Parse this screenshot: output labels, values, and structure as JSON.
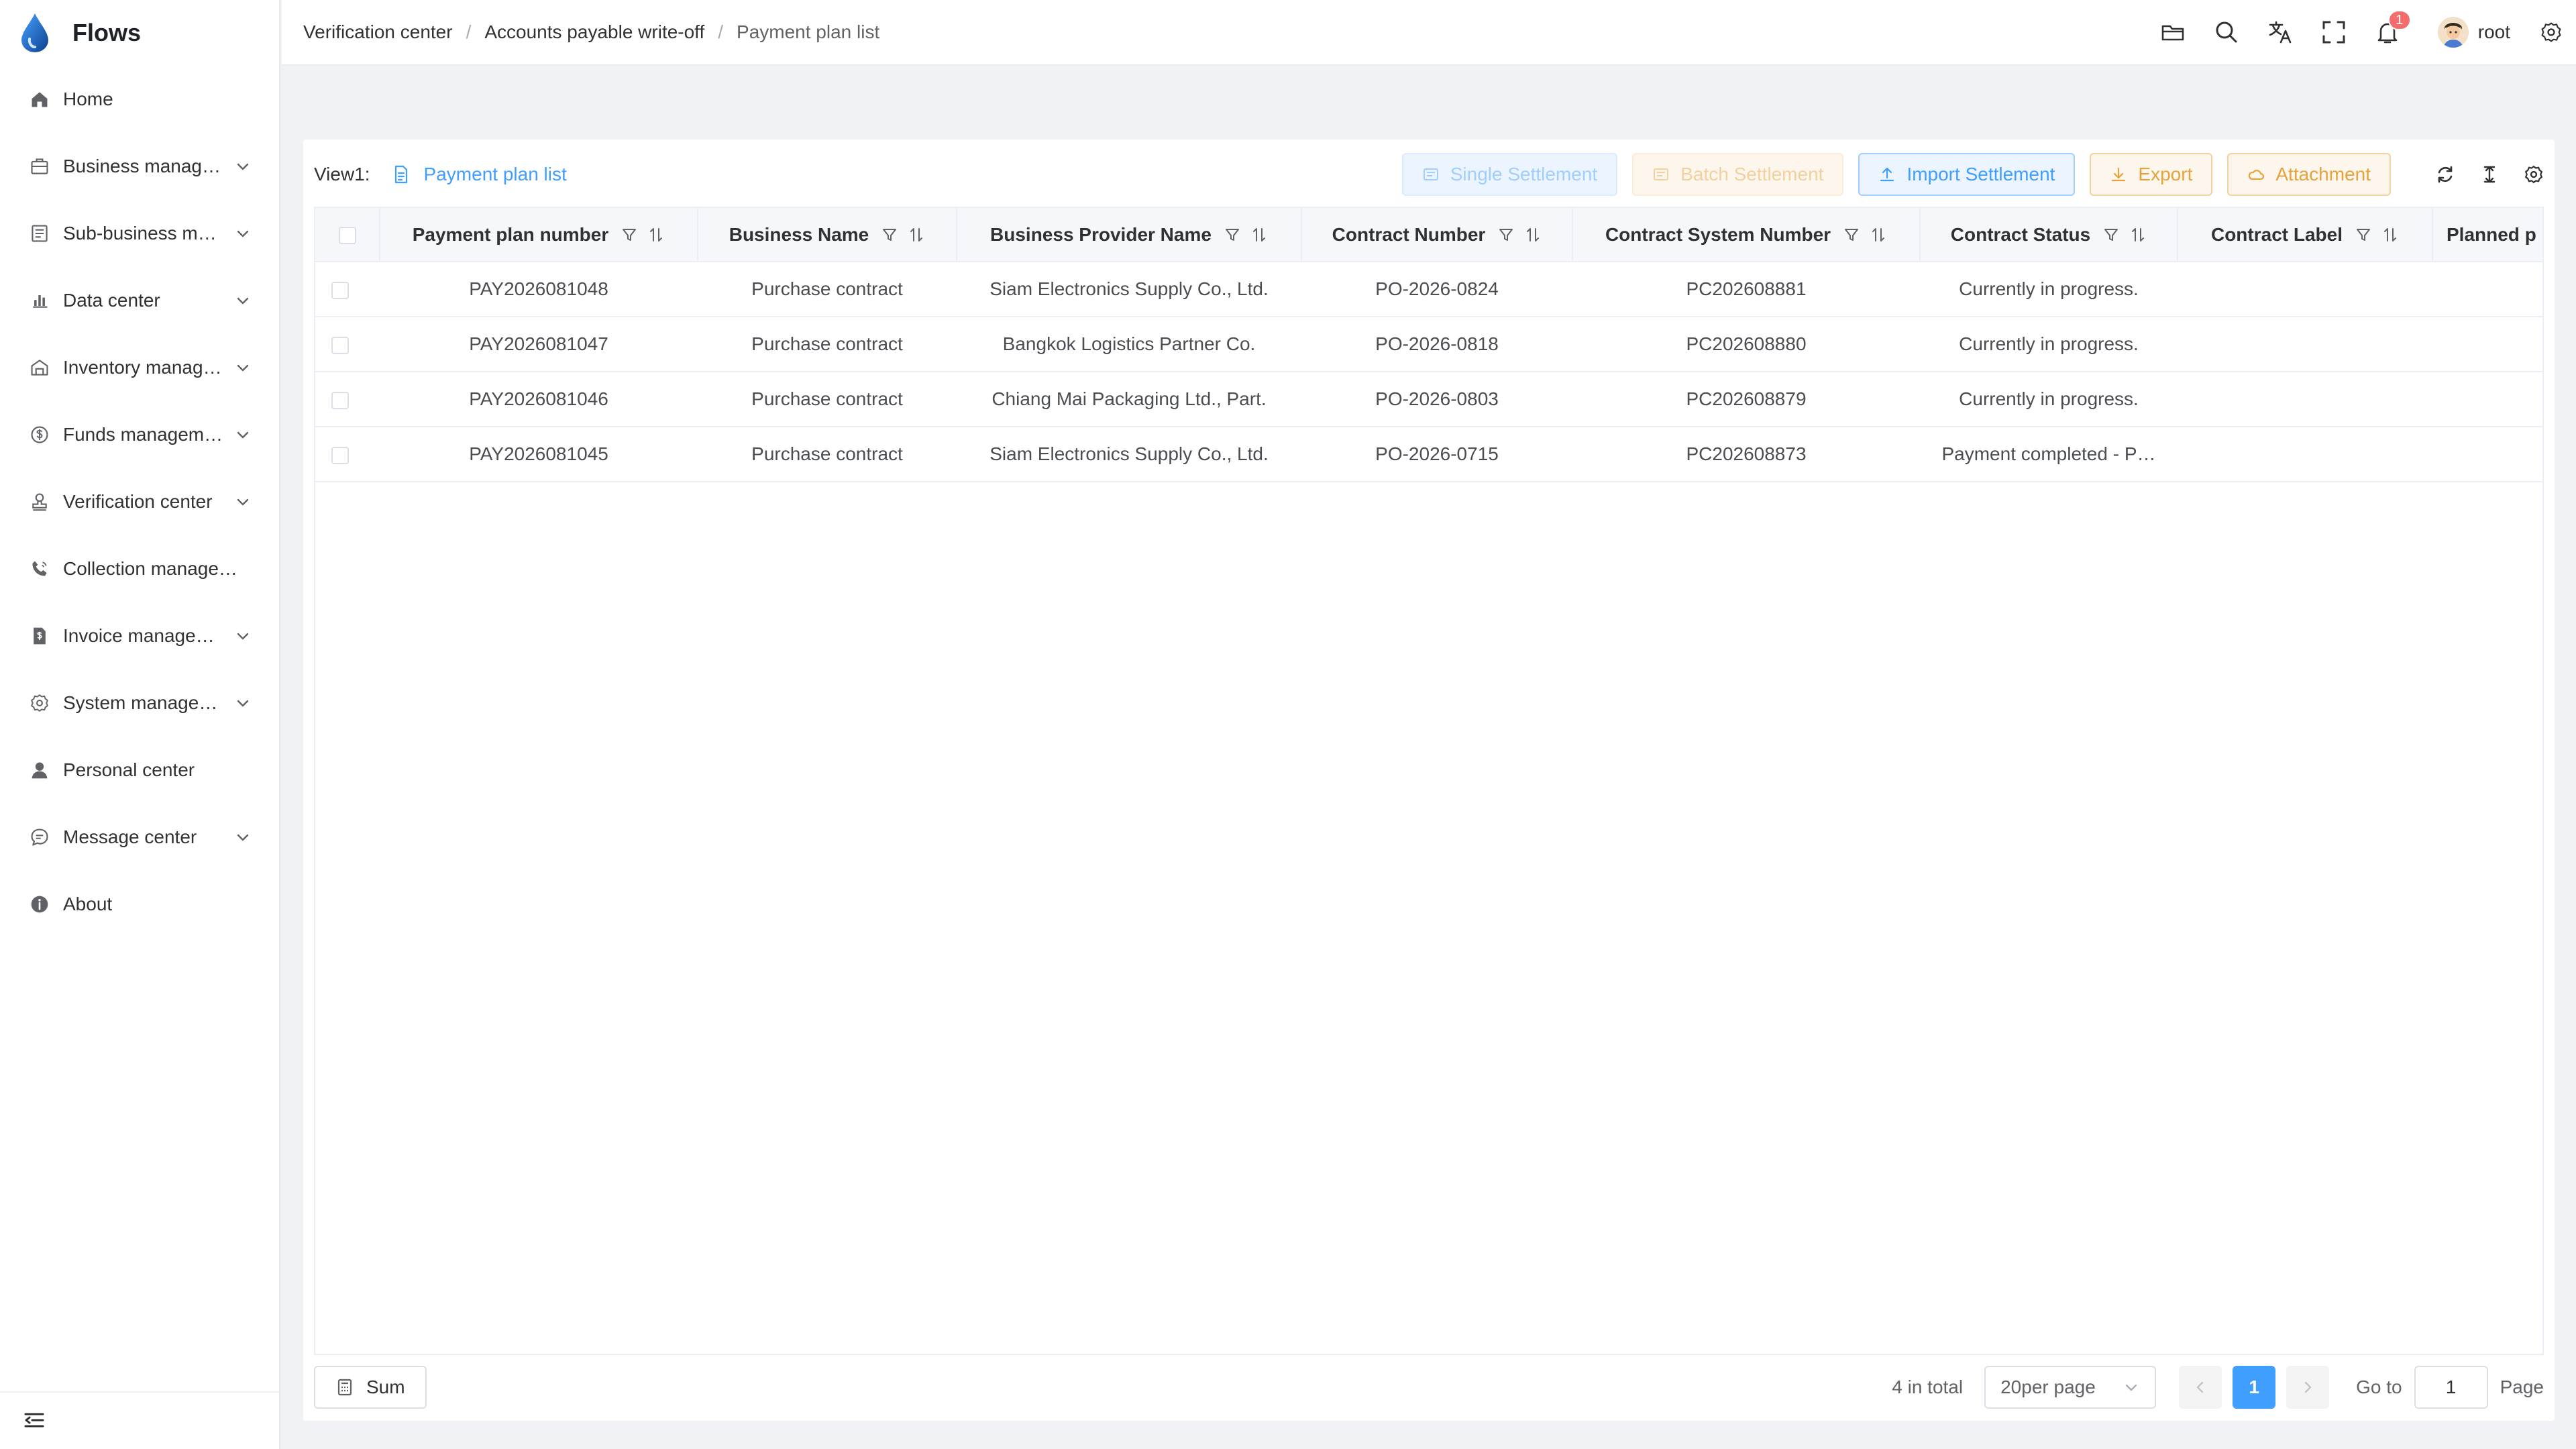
{
  "app": {
    "name": "Flows"
  },
  "sidebar": {
    "items": [
      {
        "label": "Home",
        "icon": "home-icon",
        "expandable": false
      },
      {
        "label": "Business manag…",
        "icon": "briefcase-icon",
        "expandable": true
      },
      {
        "label": "Sub-business m…",
        "icon": "list-icon",
        "expandable": true
      },
      {
        "label": "Data center",
        "icon": "bar-chart-icon",
        "expandable": true
      },
      {
        "label": "Inventory manag…",
        "icon": "warehouse-icon",
        "expandable": true
      },
      {
        "label": "Funds managem…",
        "icon": "dollar-circle-icon",
        "expandable": true
      },
      {
        "label": "Verification center",
        "icon": "stamp-icon",
        "expandable": true
      },
      {
        "label": "Collection managem…",
        "icon": "phone-icon",
        "expandable": false
      },
      {
        "label": "Invoice manage…",
        "icon": "invoice-icon",
        "expandable": true
      },
      {
        "label": "System manage…",
        "icon": "gear-icon",
        "expandable": true
      },
      {
        "label": "Personal center",
        "icon": "user-icon",
        "expandable": false
      },
      {
        "label": "Message center",
        "icon": "chat-icon",
        "expandable": true
      },
      {
        "label": "About",
        "icon": "info-icon",
        "expandable": false
      }
    ]
  },
  "header": {
    "breadcrumb": [
      "Verification center",
      "Accounts payable write-off",
      "Payment plan list"
    ],
    "notification_count": "1",
    "username": "root"
  },
  "toolbar": {
    "view_label": "View1:",
    "view_name": "Payment plan list",
    "buttons": {
      "single_settlement": "Single Settlement",
      "batch_settlement": "Batch Settlement",
      "import_settlement": "Import Settlement",
      "export": "Export",
      "attachment": "Attachment"
    }
  },
  "table": {
    "columns": [
      "Payment plan number",
      "Business Name",
      "Business Provider Name",
      "Contract Number",
      "Contract System Number",
      "Contract Status",
      "Contract Label",
      "Planned p"
    ],
    "rows": [
      [
        "PAY2026081048",
        "Purchase contract",
        "Siam Electronics Supply Co., Ltd.",
        "PO-2026-0824",
        "PC202608881",
        "Currently in progress.",
        "",
        ""
      ],
      [
        "PAY2026081047",
        "Purchase contract",
        "Bangkok Logistics Partner Co.",
        "PO-2026-0818",
        "PC202608880",
        "Currently in progress.",
        "",
        ""
      ],
      [
        "PAY2026081046",
        "Purchase contract",
        "Chiang Mai Packaging Ltd., Part.",
        "PO-2026-0803",
        "PC202608879",
        "Currently in progress.",
        "",
        ""
      ],
      [
        "PAY2026081045",
        "Purchase contract",
        "Siam Electronics Supply Co., Ltd.",
        "PO-2026-0715",
        "PC202608873",
        "Payment completed - P…",
        "",
        ""
      ]
    ]
  },
  "footer": {
    "sum_label": "Sum",
    "total_text": "4 in total",
    "page_size": "20per page",
    "current_page": "1",
    "goto_label": "Go to",
    "goto_value": "1",
    "page_suffix": "Page"
  },
  "colors": {
    "primary": "#409eff",
    "warning": "#e6a23c",
    "danger": "#f56c6c"
  }
}
